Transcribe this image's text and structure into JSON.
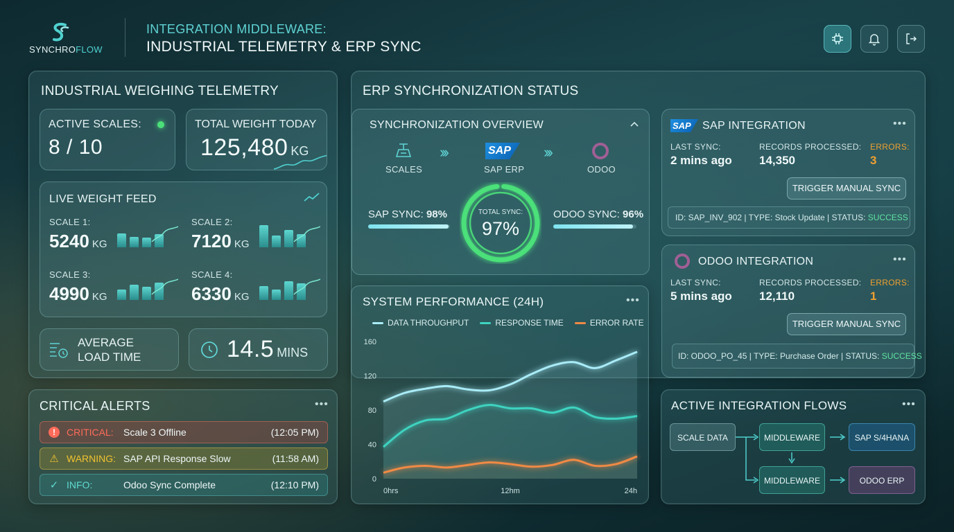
{
  "brand": {
    "name_a": "SYNCHRO",
    "name_b": "FLOW"
  },
  "header": {
    "line1": "INTEGRATION MIDDLEWARE:",
    "line2": "INDUSTRIAL TELEMETRY & ERP SYNC"
  },
  "header_icons": [
    "network-icon",
    "bell-icon",
    "logout-icon"
  ],
  "telemetry": {
    "title": "INDUSTRIAL WEIGHING TELEMETRY",
    "active_scales": {
      "label": "ACTIVE SCALES:",
      "value": "8 / 10"
    },
    "total_weight": {
      "label": "TOTAL WEIGHT TODAY",
      "value": "125,480",
      "unit": "KG"
    },
    "feed": {
      "title": "LIVE WEIGHT FEED",
      "scales": [
        {
          "label": "SCALE 1:",
          "value": "5240",
          "unit": "KG",
          "bars": [
            0.6,
            0.45,
            0.4,
            0.55
          ]
        },
        {
          "label": "SCALE 2:",
          "value": "7120",
          "unit": "KG",
          "bars": [
            0.95,
            0.5,
            0.75,
            0.55
          ]
        },
        {
          "label": "SCALE 3:",
          "value": "4990",
          "unit": "KG",
          "bars": [
            0.45,
            0.65,
            0.55,
            0.75
          ]
        },
        {
          "label": "SCALE 4:",
          "value": "6330",
          "unit": "KG",
          "bars": [
            0.6,
            0.45,
            0.8,
            0.7
          ]
        }
      ]
    },
    "avg_load": {
      "label_1": "AVERAGE",
      "label_2": "LOAD TIME"
    },
    "load_time": {
      "value": "14.5",
      "unit": "MINS"
    }
  },
  "alerts": {
    "title": "CRITICAL ALERTS",
    "items": [
      {
        "level": "CRITICAL:",
        "message": "Scale 3 Offline",
        "time": "(12:05 PM)",
        "color": "#ff6b5a"
      },
      {
        "level": "WARNING:",
        "message": "SAP API Response Slow",
        "time": "(11:58 AM)",
        "color": "#f2c230"
      },
      {
        "level": "INFO:",
        "message": "Odoo Sync Complete",
        "time": "(12:10 PM)",
        "color": "#5fdad0"
      }
    ]
  },
  "erp": {
    "title": "ERP SYNCHRONIZATION STATUS",
    "overview": {
      "title": "SYNCHRONIZATION OVERVIEW",
      "nodes": [
        "SCALES",
        "SAP ERP",
        "ODOO"
      ],
      "sap_logo": "SAP",
      "sap_sync": {
        "label": "SAP SYNC:",
        "value": "98%",
        "level": 0.98
      },
      "total": {
        "label": "TOTAL SYNC:",
        "value": "97%",
        "level": 0.97
      },
      "odoo_sync": {
        "label": "ODOO SYNC:",
        "value": "96%",
        "level": 0.96
      }
    },
    "sap": {
      "logo": "SAP",
      "title": "SAP INTEGRATION",
      "last_sync_label": "LAST SYNC:",
      "last_sync": "2 mins ago",
      "records_label": "RECORDS PROCESSED:",
      "records": "14,350",
      "errors_label": "ERRORS:",
      "errors": "3",
      "button": "TRIGGER MANUAL SYNC",
      "detail": {
        "id": "ID: SAP_INV_902",
        "type_label": "TYPE:",
        "type": "Stock Update",
        "status_label": "STATUS:",
        "status": "SUCCESS"
      }
    },
    "odoo": {
      "title": "ODOO INTEGRATION",
      "last_sync_label": "LAST SYNC:",
      "last_sync": "5 mins ago",
      "records_label": "RECORDS PROCESSED:",
      "records": "12,110",
      "errors_label": "ERRORS:",
      "errors": "1",
      "button": "TRIGGER MANUAL SYNC",
      "detail": {
        "id": "ID: ODOO_PO_45",
        "type_label": "TYPE:",
        "type": "Purchase Order",
        "status_label": "STATUS:",
        "status": "SUCCESS"
      }
    }
  },
  "performance": {
    "title": "SYSTEM PERFORMANCE (24H)"
  },
  "chart_data": {
    "type": "area",
    "title": "SYSTEM PERFORMANCE (24H)",
    "x": [
      0,
      2,
      4,
      6,
      8,
      10,
      12,
      14,
      16,
      18,
      20,
      22,
      24
    ],
    "x_tick_labels": [
      "0hrs",
      "12hm",
      "24h"
    ],
    "y_ticks": [
      0,
      40,
      80,
      120,
      160
    ],
    "ylim": [
      0,
      160
    ],
    "series": [
      {
        "name": "DATA THROUGHPUT",
        "color": "#a9ecf7",
        "values": [
          90,
          100,
          105,
          108,
          104,
          103,
          110,
          122,
          132,
          136,
          129,
          138,
          148
        ]
      },
      {
        "name": "RESPONSE TIME",
        "color": "#3ed3c0",
        "values": [
          37,
          57,
          68,
          70,
          80,
          86,
          82,
          82,
          77,
          83,
          72,
          70,
          73
        ]
      },
      {
        "name": "ERROR RATE",
        "color": "#f08a45",
        "values": [
          7,
          13,
          15,
          13,
          16,
          19,
          17,
          14,
          16,
          22,
          15,
          17,
          26
        ]
      }
    ],
    "grid": false,
    "legend": "top"
  },
  "flows": {
    "title": "ACTIVE INTEGRATION FLOWS",
    "nodes": {
      "scale_data": "SCALE DATA",
      "middleware_1": "MIDDLEWARE",
      "middleware_2": "MIDDLEWARE",
      "sap": "SAP S/4HANA",
      "odoo": "ODOO ERP"
    }
  },
  "menu_glyph": "•••"
}
